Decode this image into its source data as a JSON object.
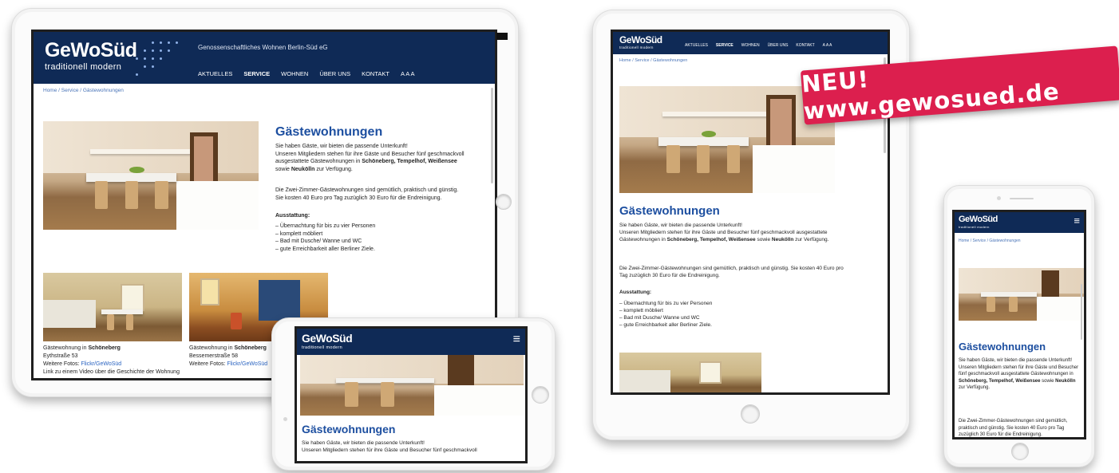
{
  "site": {
    "logo_main": "GeWoSüd",
    "logo_sub": "traditionell modern",
    "tagline": "Genossenschaftliches Wohnen Berlin-Süd eG",
    "nav": [
      "AKTUELLES",
      "SERVICE",
      "WOHNEN",
      "ÜBER UNS",
      "KONTAKT",
      "A A A"
    ],
    "active_nav": "SERVICE",
    "breadcrumb": "Home / Service / Gästewohnungen",
    "page_title": "Gästewohnungen",
    "intro_line1": "Sie haben Gäste, wir bieten die passende Unterkunft!",
    "intro_line2_a": "Unseren Mitgliedern stehen für ihre Gäste und Besucher fünf geschmackvoll ausgestattete Gästewohnungen in ",
    "intro_bold": "Schöneberg, Tempelhof, Weißensee",
    "intro_mid": " sowie ",
    "intro_bold2": "Neukölln",
    "intro_end": " zur Verfügung.",
    "price_text": "Die Zwei-Zimmer-Gästewohnungen sind gemütlich, praktisch und günstig. Sie kosten 40 Euro pro Tag zuzüglich 30 Euro für die Endreinigung.",
    "features_title": "Ausstattung:",
    "features": [
      "Übernachtung für bis zu vier Personen",
      "komplett möbliert",
      "Bad mit Dusche/ Wanne und WC",
      "gute Erreichbarkeit aller Berliner Ziele."
    ],
    "apt1": {
      "title_a": "Gästewohnung in ",
      "title_b": "Schöneberg",
      "street": "Eythstraße 53",
      "photos_label": "Weitere Fotos: ",
      "photos_link": "Flickr/GeWoSüd",
      "video": "Link zu einem Video über die Geschichte der Wohnung"
    },
    "apt2": {
      "title_a": "Gästewohnung in ",
      "title_b": "Schöneberg",
      "street": "Bessemerstraße 58",
      "photos_label": "Weitere Fotos: ",
      "photos_link": "Flickr/GeWoSüd"
    },
    "mobile_intro_a": "Unseren Mitgliedern stehen für ihre Gäste und Besucher fünf geschmackvoll",
    "burger": "≡"
  },
  "banner": {
    "text": "NEU! www.gewosued.de"
  },
  "colors": {
    "header": "#0f2a56",
    "title": "#1d4fa0",
    "banner": "#dc1f4e",
    "link": "#2b64c1"
  }
}
